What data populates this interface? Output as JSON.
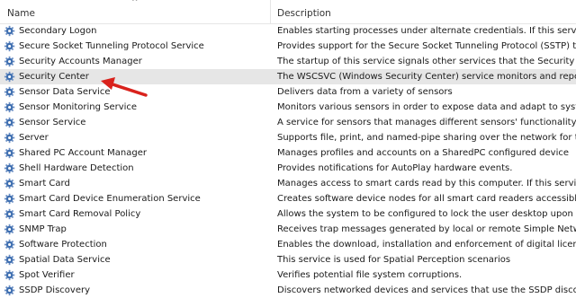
{
  "columns": {
    "name": "Name",
    "description": "Description"
  },
  "icons": {
    "service": "gear-icon",
    "sort": "sort-ascending-icon",
    "annotation": "red-arrow-icon"
  },
  "colors": {
    "selected_row": "#e6e6e6",
    "arrow": "#d9221c",
    "gear_blue": "#3f6fb0"
  },
  "services": [
    {
      "name": "Secondary Logon",
      "description": "Enables starting processes under alternate credentials. If this service is st"
    },
    {
      "name": "Secure Socket Tunneling Protocol Service",
      "description": "Provides support for the Secure Socket Tunneling Protocol (SSTP) to co"
    },
    {
      "name": "Security Accounts Manager",
      "description": "The startup of this service signals other services that the Security Acco"
    },
    {
      "name": "Security Center",
      "description": "The WSCSVC (Windows Security Center) service monitors and reports s"
    },
    {
      "name": "Sensor Data Service",
      "description": "Delivers data from a variety of sensors"
    },
    {
      "name": "Sensor Monitoring Service",
      "description": "Monitors various sensors in order to expose data and adapt to system a"
    },
    {
      "name": "Sensor Service",
      "description": "A service for sensors that manages different sensors' functionality. Ma"
    },
    {
      "name": "Server",
      "description": "Supports file, print, and named-pipe sharing over the network for this c"
    },
    {
      "name": "Shared PC Account Manager",
      "description": "Manages profiles and accounts on a SharedPC configured device"
    },
    {
      "name": "Shell Hardware Detection",
      "description": "Provides notifications for AutoPlay hardware events."
    },
    {
      "name": "Smart Card",
      "description": "Manages access to smart cards read by this computer. If this service is s"
    },
    {
      "name": "Smart Card Device Enumeration Service",
      "description": "Creates software device nodes for all smart card readers accessible to a"
    },
    {
      "name": "Smart Card Removal Policy",
      "description": "Allows the system to be configured to lock the user desktop upon smar"
    },
    {
      "name": "SNMP Trap",
      "description": "Receives trap messages generated by local or remote Simple Network"
    },
    {
      "name": "Software Protection",
      "description": "Enables the download, installation and enforcement of digital licenses f"
    },
    {
      "name": "Spatial Data Service",
      "description": "This service is used for Spatial Perception scenarios"
    },
    {
      "name": "Spot Verifier",
      "description": "Verifies potential file system corruptions."
    },
    {
      "name": "SSDP Discovery",
      "description": "Discovers networked devices and services that use the SSDP discovery"
    }
  ],
  "selected_index": 3
}
